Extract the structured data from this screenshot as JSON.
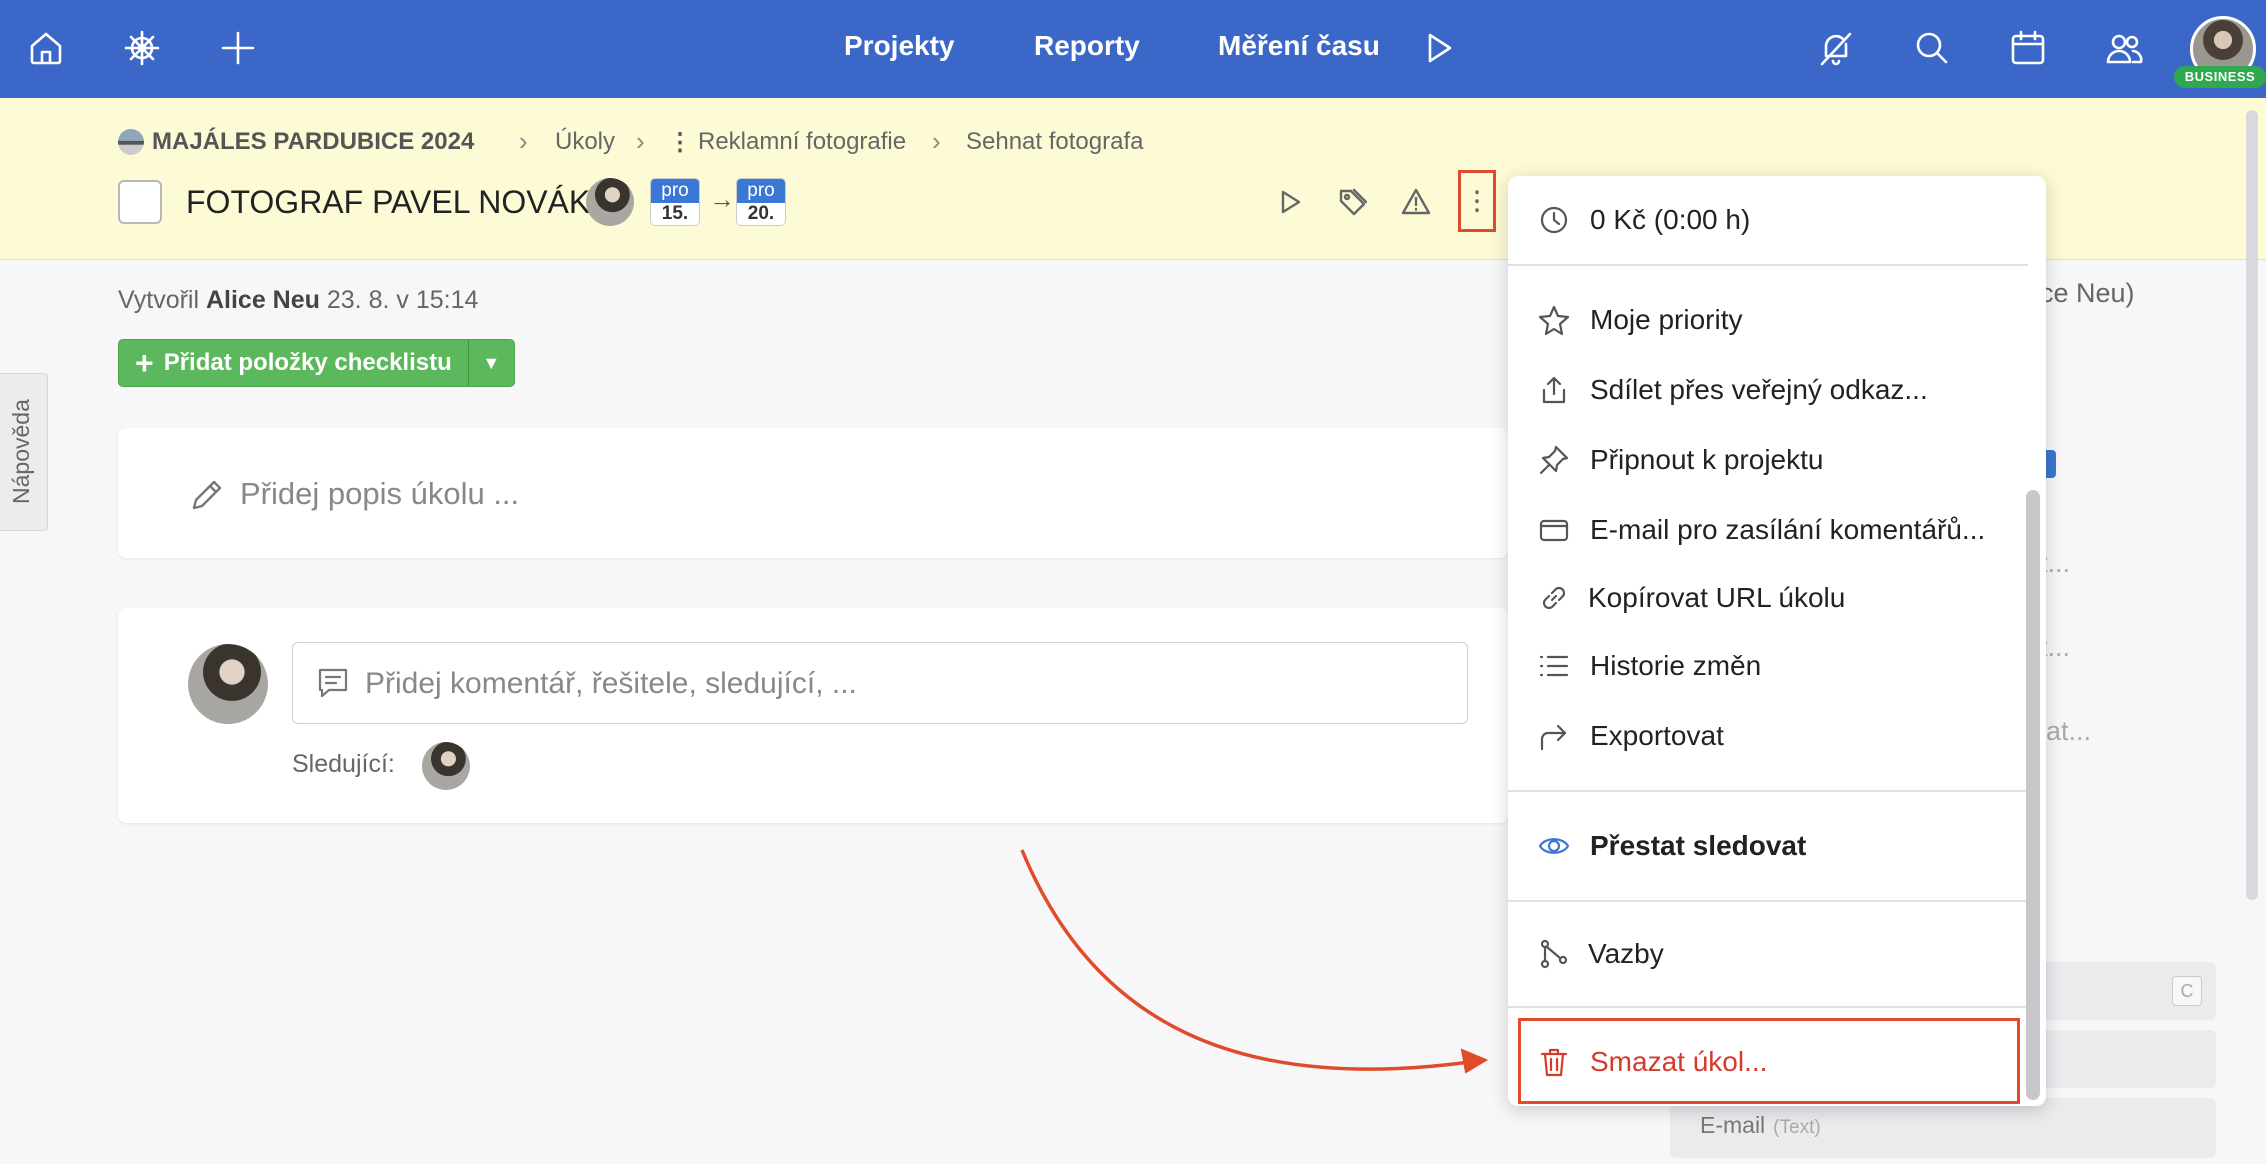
{
  "topbar": {
    "nav": [
      "Projekty",
      "Reporty",
      "Měření času"
    ],
    "icons": [
      "home-icon",
      "ship-wheel-icon",
      "plus-icon",
      "play-icon",
      "bell-off-icon",
      "search-icon",
      "calendar-icon",
      "users-icon"
    ],
    "badge": "BUSINESS",
    "bg_color": "#3b68c8"
  },
  "breadcrumb": {
    "project": "MAJÁLES PARDUBICE 2024",
    "items": [
      "Úkoly",
      "Reklamní fotografie",
      "Sehnat fotografa"
    ]
  },
  "task": {
    "title": "FOTOGRAF PAVEL NOVÁK",
    "start_day_label": "pro",
    "start_day": "15.",
    "end_day_label": "pro",
    "end_day": "20."
  },
  "meta": {
    "created_prefix": "Vytvořil",
    "created_by": "Alice Neu",
    "created_at": "23. 8. v 15:14"
  },
  "checklist_button": "Přidat položky checklistu",
  "description_placeholder": "Přidej popis úkolu ...",
  "comment": {
    "placeholder": "Přidej komentář, řešitele, sledující, ...",
    "followers_label": "Sledující:"
  },
  "help_tab": "Nápověda",
  "side": {
    "partial_name": "Alice Neu)",
    "partial_1": "t...",
    "partial_2": "t...",
    "partial_3": "lat...",
    "shortcut_key": "C",
    "email_label": "E-mail",
    "email_type": "(Text)"
  },
  "menu": {
    "time": "0 Kč (0:00 h)",
    "items": [
      {
        "label": "Moje priority",
        "icon": "star-icon"
      },
      {
        "label": "Sdílet přes veřejný odkaz...",
        "icon": "share-icon"
      },
      {
        "label": "Připnout k projektu",
        "icon": "pin-icon"
      },
      {
        "label": "E-mail pro zasílání komentářů...",
        "icon": "envelope-icon"
      },
      {
        "label": "Kopírovat URL úkolu",
        "icon": "link-icon"
      },
      {
        "label": "Historie změn",
        "icon": "list-icon"
      },
      {
        "label": "Exportovat",
        "icon": "forward-icon"
      }
    ],
    "unfollow": "Přestat sledovat",
    "relations": "Vazby",
    "delete": "Smazat úkol..."
  },
  "colors": {
    "accent": "#3b68c8",
    "danger": "#d63a2a",
    "highlight": "#e04b2a",
    "success": "#5cb85c",
    "header_bg": "#fdfbd6"
  }
}
